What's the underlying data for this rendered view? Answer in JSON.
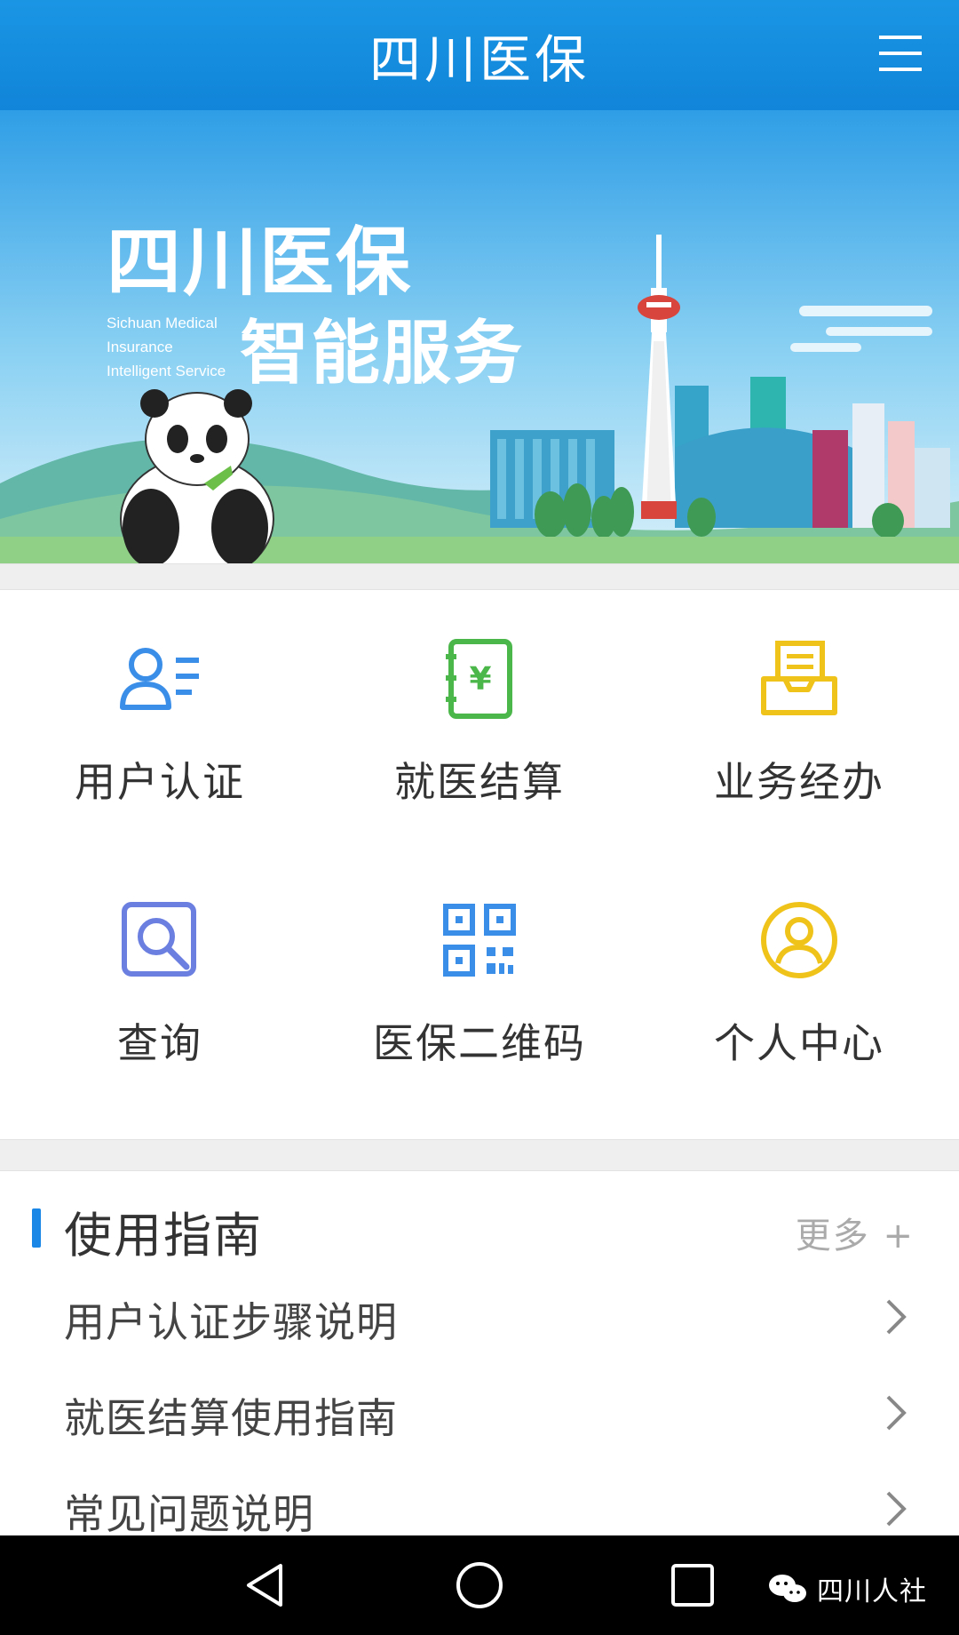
{
  "header": {
    "title": "四川医保",
    "menu_icon": "hamburger-menu-icon"
  },
  "banner": {
    "title_cn": "四川医保",
    "subtitle_cn": "智能服务",
    "subtitle_en_line1": "Sichuan Medical",
    "subtitle_en_line2": "Insurance",
    "subtitle_en_line3": "Intelligent Service"
  },
  "services": [
    {
      "label": "用户认证",
      "icon": "user-auth-icon",
      "color": "#3a8ee8"
    },
    {
      "label": "就医结算",
      "icon": "medical-settlement-icon",
      "color": "#4bb649"
    },
    {
      "label": "业务经办",
      "icon": "business-handling-icon",
      "color": "#f0c31a"
    },
    {
      "label": "查询",
      "icon": "search-query-icon",
      "color": "#6b7fe0"
    },
    {
      "label": "医保二维码",
      "icon": "qr-code-icon",
      "color": "#3a8ee8"
    },
    {
      "label": "个人中心",
      "icon": "personal-center-icon",
      "color": "#f0c31a"
    }
  ],
  "guide": {
    "title": "使用指南",
    "more": "更多 +",
    "items": [
      {
        "label": "用户认证步骤说明"
      },
      {
        "label": "就医结算使用指南"
      },
      {
        "label": "常见问题说明"
      }
    ]
  },
  "navbar": {
    "back_icon": "back-triangle-icon",
    "home_icon": "home-circle-icon",
    "recents_icon": "recents-square-icon",
    "watermark": "四川人社"
  },
  "colors": {
    "primary": "#1a8fe3",
    "accent_bar": "#1a86e6",
    "navbar": "#000000"
  }
}
